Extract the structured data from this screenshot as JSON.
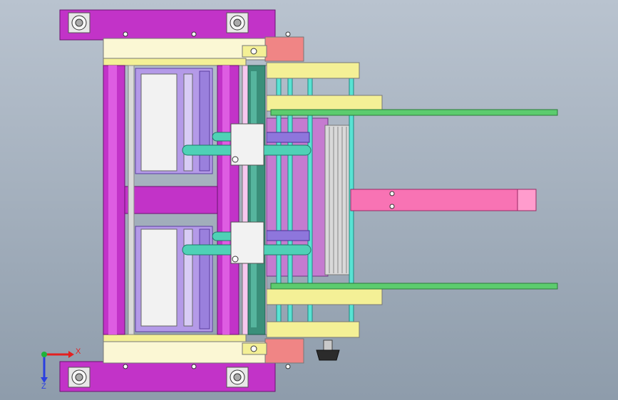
{
  "viewport": {
    "background_top": "#b9c3cf",
    "background_bottom": "#8e9cab"
  },
  "colors": {
    "magenta": "#c233c8",
    "magenta_dark": "#8e1e93",
    "cream": "#fbf7d4",
    "yellow": "#f4f096",
    "lavender": "#b49ae8",
    "lavender_dark": "#7d62c9",
    "teal": "#3a8f7a",
    "cyan": "#59e3d4",
    "pink": "#f873b4",
    "salmon": "#f08585",
    "green_rail": "#5ccc6e",
    "grey": "#c9c9c9",
    "dark": "#2b2b2b"
  },
  "triad": {
    "x_label": "X",
    "z_label": "Z",
    "x_color": "#e32020",
    "z_color": "#2a3fe0",
    "y_color": "#1fb33a"
  }
}
